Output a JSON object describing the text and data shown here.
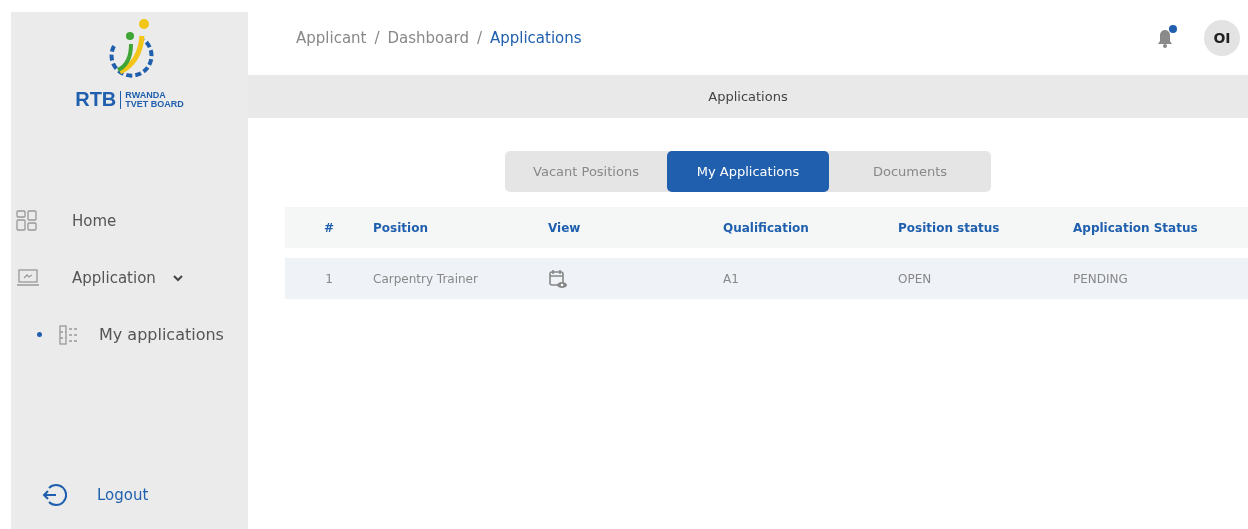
{
  "logo": {
    "abbr": "RTB",
    "line1": "RWANDA",
    "line2": "TVET BOARD"
  },
  "sidebar": {
    "items": [
      {
        "label": "Home",
        "selected": false
      },
      {
        "label": "Application",
        "selected": false,
        "expanded": true,
        "children": [
          {
            "label": "My applications",
            "selected": true
          }
        ]
      }
    ],
    "logout": "Logout"
  },
  "breadcrumb": {
    "separator": "/",
    "items": [
      "Applicant",
      "Dashboard",
      "Applications"
    ]
  },
  "header": {
    "unread": true,
    "avatar": "OI"
  },
  "page_title": "Applications",
  "tabs": [
    {
      "label": "Vacant Positions",
      "selected": false
    },
    {
      "label": "My Applications",
      "selected": true
    },
    {
      "label": "Documents",
      "selected": false
    }
  ],
  "table": {
    "columns": [
      "#",
      "Position",
      "View",
      "Qualification",
      "Position status",
      "Application Status"
    ],
    "rows": [
      {
        "cells": [
          "1",
          "Carpentry Trainer",
          null,
          "A1",
          "OPEN",
          "PENDING"
        ]
      }
    ]
  }
}
